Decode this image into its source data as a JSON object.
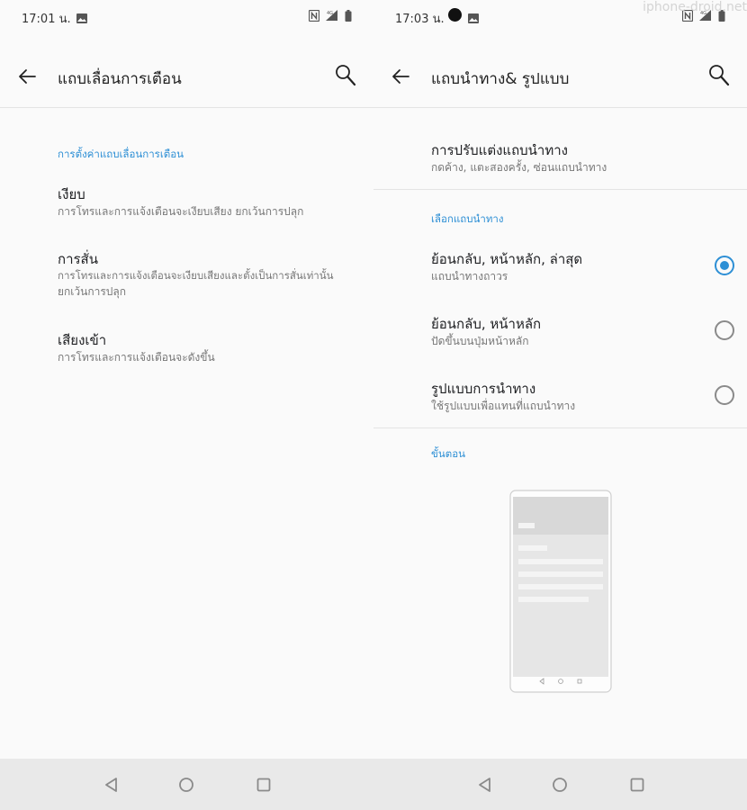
{
  "left": {
    "status": {
      "time": "17:01 น."
    },
    "appbar": {
      "title": "แถบเลื่อนการเตือน"
    },
    "section_label": "การตั้งค่าแถบเลื่อนการเตือน",
    "items": [
      {
        "title": "เงียบ",
        "summary": "การโทรและการแจ้งเตือนจะเงียบเสียง ยกเว้นการปลุก"
      },
      {
        "title": "การสั่น",
        "summary_line1": "การโทรและการแจ้งเตือนจะเงียบเสียงและตั้งเป็นการสั่นเท่านั้น",
        "summary_line2": "ยกเว้นการปลุก"
      },
      {
        "title": "เสียงเข้า",
        "summary": "การโทรและการแจ้งเตือนจะดังขึ้น"
      }
    ]
  },
  "right": {
    "status": {
      "time": "17:03 น."
    },
    "appbar": {
      "title": "แถบนำทาง& รูปแบบ"
    },
    "customize": {
      "title": "การปรับแต่งแถบนำทาง",
      "summary": "กดค้าง, แตะสองครั้ง, ซ่อนแถบนำทาง"
    },
    "section_label": "เลือกแถบนำทาง",
    "options": [
      {
        "title": "ย้อนกลับ, หน้าหลัก, ล่าสุด",
        "summary": "แถบนำทางถาวร",
        "selected": true
      },
      {
        "title": "ย้อนกลับ, หน้าหลัก",
        "summary": "ปัดขึ้นบนปุ่มหน้าหลัก",
        "selected": false
      },
      {
        "title": "รูปแบบการนำทาง",
        "summary": "ใช้รูปแบบเพื่อแทนที่แถบนำทาง",
        "selected": false
      }
    ],
    "steps_label": "ขั้นตอน"
  },
  "watermark": "iphone-droid.net",
  "colors": {
    "accent": "#2d8fd5",
    "background": "#fafafa",
    "navbar": "#e9e9e9"
  },
  "icons": {
    "status": [
      "image-icon",
      "nfc-icon",
      "4g-signal-icon",
      "battery-icon",
      "record-dot-icon"
    ],
    "appbar": [
      "back-arrow-icon",
      "search-icon"
    ],
    "navbar": [
      "back-triangle-icon",
      "home-circle-icon",
      "recents-square-icon"
    ]
  }
}
